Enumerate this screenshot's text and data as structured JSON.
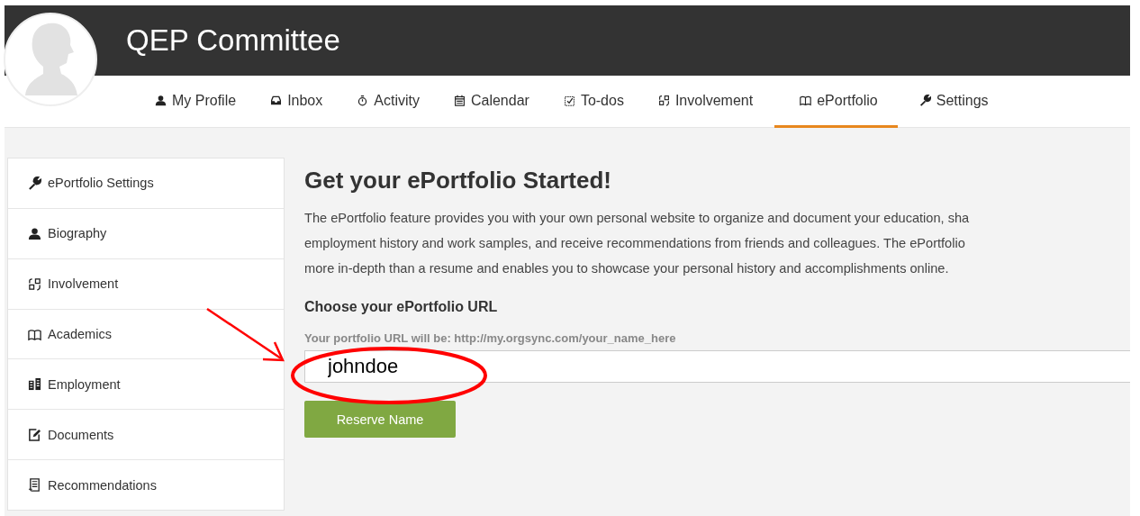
{
  "header": {
    "title": "QEP Committee"
  },
  "nav": [
    {
      "label": "My Profile",
      "selected": false
    },
    {
      "label": "Inbox",
      "selected": false
    },
    {
      "label": "Activity",
      "selected": false
    },
    {
      "label": "Calendar",
      "selected": false
    },
    {
      "label": "To-dos",
      "selected": false
    },
    {
      "label": "Involvement",
      "selected": false
    },
    {
      "label": "ePortfolio",
      "selected": true
    },
    {
      "label": "Settings",
      "selected": false
    }
  ],
  "sidebar": {
    "items": [
      {
        "label": "ePortfolio Settings"
      },
      {
        "label": "Biography"
      },
      {
        "label": "Involvement"
      },
      {
        "label": "Academics"
      },
      {
        "label": "Employment"
      },
      {
        "label": "Documents"
      },
      {
        "label": "Recommendations"
      }
    ]
  },
  "main": {
    "heading": "Get your ePortfolio Started!",
    "description_lines": [
      "The ePortfolio feature provides you with your own personal website to organize and document your education, sha",
      "employment history and work samples, and receive recommendations from friends and colleagues. The ePortfolio",
      "more in-depth than a resume and enables you to showcase your personal history and accomplishments online."
    ],
    "url_label": "Choose your ePortfolio URL",
    "url_hint": "Your portfolio URL will be: http://my.orgsync.com/your_name_here",
    "url_value": "johndoe",
    "button": "Reserve Name"
  },
  "annotations": {
    "arrow": true,
    "ellipse": true
  }
}
